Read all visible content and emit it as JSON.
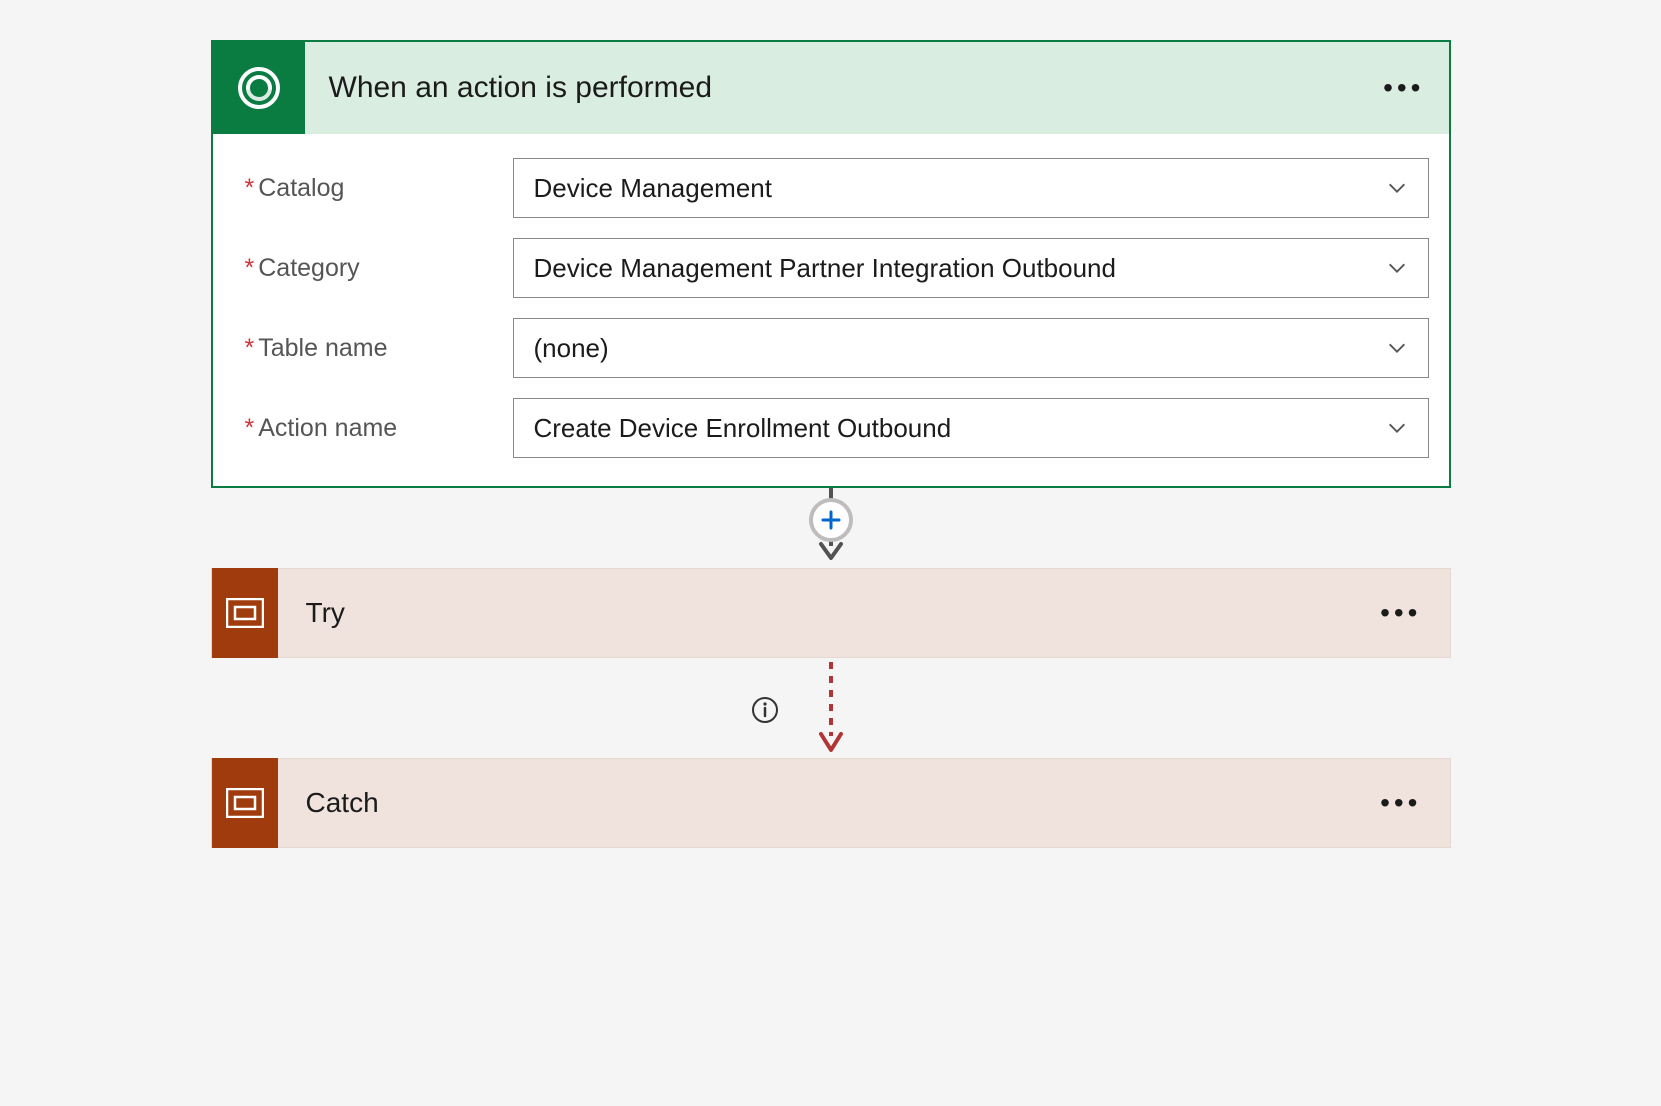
{
  "trigger": {
    "title": "When an action is performed",
    "icon_name": "dataverse-swirl-icon",
    "accent_color": "#0a7c42",
    "header_bg": "#d9ede1",
    "fields": {
      "catalog": {
        "label": "Catalog",
        "value": "Device Management"
      },
      "category": {
        "label": "Category",
        "value": "Device Management Partner Integration Outbound"
      },
      "table_name": {
        "label": "Table name",
        "value": "(none)"
      },
      "action_name": {
        "label": "Action name",
        "value": "Create Device Enrollment Outbound"
      }
    }
  },
  "steps": {
    "try": {
      "title": "Try",
      "accent_color": "#a03b0e",
      "bg": "#f0e3de",
      "icon_name": "scope-icon"
    },
    "catch": {
      "title": "Catch",
      "accent_color": "#a03b0e",
      "bg": "#f0e3de",
      "icon_name": "scope-icon"
    }
  },
  "connector": {
    "run_after_dashed_color": "#b23535",
    "arrow_color": "#525252"
  }
}
